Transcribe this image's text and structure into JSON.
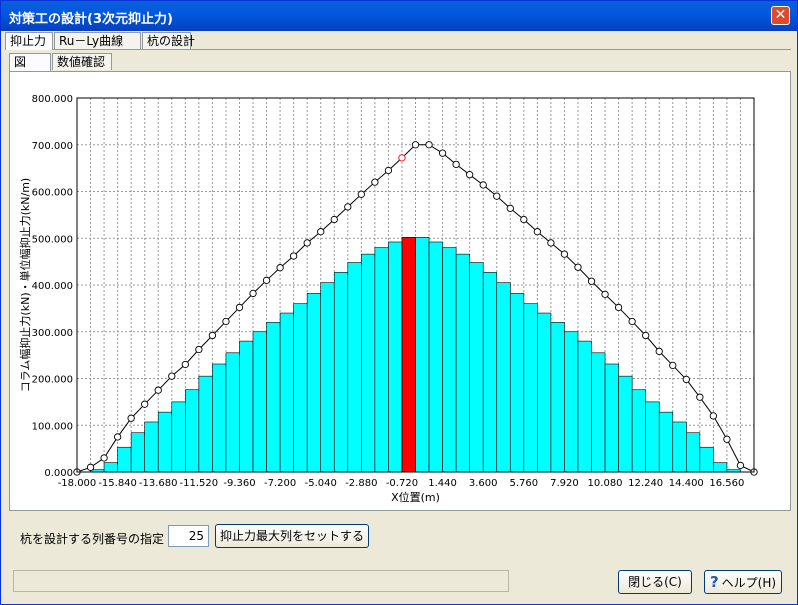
{
  "window": {
    "title": "対策工の設計(3次元抑止力)",
    "close_glyph": "✕"
  },
  "tabs": [
    {
      "label": "抑止力",
      "active": true
    },
    {
      "label": "Ru－Ly曲線",
      "active": false
    },
    {
      "label": "杭の設計",
      "active": false
    }
  ],
  "subtabs": [
    {
      "label": "図",
      "active": true
    },
    {
      "label": "数値確認",
      "active": false
    }
  ],
  "controls": {
    "pile_row_label": "杭を設計する列番号の指定",
    "pile_row_value": "25",
    "set_max_button": "抑止力最大列をセットする"
  },
  "footer": {
    "close_button": "閉じる(C)",
    "help_button": "ヘルプ(H)",
    "status_text": ""
  },
  "colors": {
    "bar": "#00ffff",
    "bar_highlight": "#ff0000",
    "line": "#000000",
    "marker_highlight": "#ff0000",
    "title_bar": "#0358e0"
  },
  "icons": {
    "help": "question-mark-icon",
    "close": "close-x-icon"
  },
  "chart_data": {
    "type": "bar",
    "xlabel": "X位置(m)",
    "ylabel": "コラム幅抑止力(kN)・単位幅抑止力(kN/m)",
    "ylim": [
      0,
      800
    ],
    "xlim": [
      -18,
      18
    ],
    "grid": true,
    "y_tick_labels": [
      "0.000",
      "100.000",
      "200.000",
      "300.000",
      "400.000",
      "500.000",
      "600.000",
      "700.000",
      "800.000"
    ],
    "x_tick_labels": [
      "-18.000",
      "-15.840",
      "-13.680",
      "-11.520",
      "-9.360",
      "-7.200",
      "-5.040",
      "-2.880",
      "-0.720",
      "1.440",
      "3.600",
      "5.760",
      "7.920",
      "10.080",
      "12.240",
      "14.400",
      "16.560"
    ],
    "bar_width": 0.72,
    "bars": {
      "x": [
        -16.92,
        -16.2,
        -15.48,
        -14.76,
        -14.04,
        -13.32,
        -12.6,
        -11.88,
        -11.16,
        -10.44,
        -9.72,
        -9.0,
        -8.28,
        -7.56,
        -6.84,
        -6.12,
        -5.4,
        -4.68,
        -3.96,
        -3.24,
        -2.52,
        -1.8,
        -1.08,
        -0.36,
        0.36,
        1.08,
        1.8,
        2.52,
        3.24,
        3.96,
        4.68,
        5.4,
        6.12,
        6.84,
        7.56,
        8.28,
        9.0,
        9.72,
        10.44,
        11.16,
        11.88,
        12.6,
        13.32,
        14.04,
        14.76,
        15.48,
        16.2,
        16.92
      ],
      "values": [
        5,
        20,
        53,
        84,
        107,
        128,
        150,
        176,
        205,
        231,
        255,
        280,
        300,
        320,
        340,
        360,
        382,
        405,
        427,
        448,
        466,
        480,
        492,
        502,
        502,
        492,
        480,
        466,
        448,
        427,
        405,
        382,
        360,
        340,
        320,
        300,
        280,
        255,
        231,
        205,
        176,
        150,
        128,
        107,
        84,
        53,
        20,
        5
      ],
      "highlight_index": 23
    },
    "line": {
      "x": [
        -18.0,
        -17.28,
        -16.56,
        -15.84,
        -15.12,
        -14.4,
        -13.68,
        -12.96,
        -12.24,
        -11.52,
        -10.8,
        -10.08,
        -9.36,
        -8.64,
        -7.92,
        -7.2,
        -6.48,
        -5.76,
        -5.04,
        -4.32,
        -3.6,
        -2.88,
        -2.16,
        -1.44,
        -0.72,
        0.0,
        0.72,
        1.44,
        2.16,
        2.88,
        3.6,
        4.32,
        5.04,
        5.76,
        6.48,
        7.2,
        7.92,
        8.64,
        9.36,
        10.08,
        10.8,
        11.52,
        12.24,
        12.96,
        13.68,
        14.4,
        15.12,
        15.84,
        16.56,
        17.28,
        18.0
      ],
      "values": [
        0,
        10,
        30,
        75,
        115,
        145,
        175,
        205,
        230,
        262,
        292,
        322,
        352,
        382,
        410,
        437,
        462,
        490,
        514,
        540,
        567,
        594,
        620,
        645,
        672,
        700,
        700,
        682,
        658,
        636,
        614,
        590,
        564,
        540,
        514,
        490,
        466,
        438,
        408,
        380,
        352,
        322,
        292,
        258,
        228,
        198,
        160,
        120,
        70,
        14,
        0
      ],
      "highlight_index": 24
    }
  }
}
